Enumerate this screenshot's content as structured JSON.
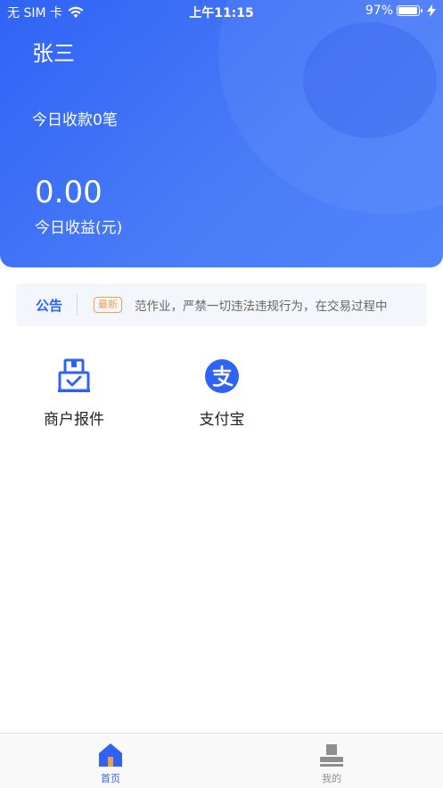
{
  "status_bar": {
    "carrier": "无 SIM 卡",
    "time": "上午11:15",
    "battery": "97%",
    "battery_level": 0.97,
    "wifi_icon": "wifi-icon",
    "charging_icon": "bolt-icon"
  },
  "hero": {
    "name": "张三",
    "today_count": "今日收款0笔",
    "amount": "0.00",
    "amount_label": "今日收益(元)"
  },
  "notice": {
    "title": "公告",
    "badge": "最新",
    "text": "范作业，严禁一切违法违规行为，在交易过程中"
  },
  "features": [
    {
      "label": "商户报件",
      "icon": "merchant-register-icon"
    },
    {
      "label": "支付宝",
      "icon": "alipay-icon"
    }
  ],
  "tabbar": {
    "items": [
      {
        "label": "首页",
        "icon": "home-icon",
        "active": true
      },
      {
        "label": "我的",
        "icon": "profile-icon",
        "active": false
      }
    ]
  },
  "colors": {
    "primary": "#2f63f5",
    "badge": "#f0a04a",
    "tab_inactive": "#8e8e8e"
  }
}
